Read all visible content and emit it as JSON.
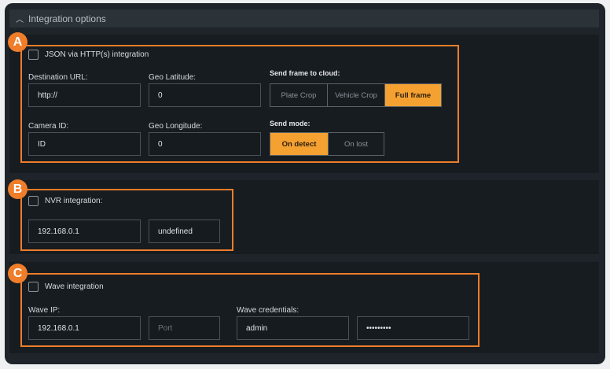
{
  "header": {
    "title": "Integration options",
    "icon": "chevron-up-icon"
  },
  "sections": {
    "a": {
      "badge": "A",
      "checkbox_label": "JSON via HTTP(s) integration",
      "checked": false,
      "destination_url": {
        "label": "Destination URL:",
        "value": "http://"
      },
      "geo_latitude": {
        "label": "Geo Latitude:",
        "value": "0"
      },
      "camera_id": {
        "label": "Camera ID:",
        "value": "ID"
      },
      "geo_longitude": {
        "label": "Geo Longitude:",
        "value": "0"
      },
      "send_frame": {
        "label": "Send frame to cloud:",
        "options": [
          "Plate Crop",
          "Vehicle Crop",
          "Full frame"
        ],
        "selected": "Full frame"
      },
      "send_mode": {
        "label": "Send mode:",
        "options": [
          "On detect",
          "On lost"
        ],
        "selected": "On detect"
      }
    },
    "b": {
      "badge": "B",
      "checkbox_label": "NVR integration:",
      "checked": false,
      "ip": "192.168.0.1",
      "type": "undefined"
    },
    "c": {
      "badge": "C",
      "checkbox_label": "Wave integration",
      "checked": false,
      "wave_ip": {
        "label": "Wave IP:",
        "value": "192.168.0.1",
        "port_placeholder": "Port"
      },
      "credentials": {
        "label": "Wave credentials:",
        "username": "admin",
        "password": "•••••••••"
      }
    }
  },
  "colors": {
    "accent": "#f5a131",
    "highlight": "#ef7d2a"
  }
}
